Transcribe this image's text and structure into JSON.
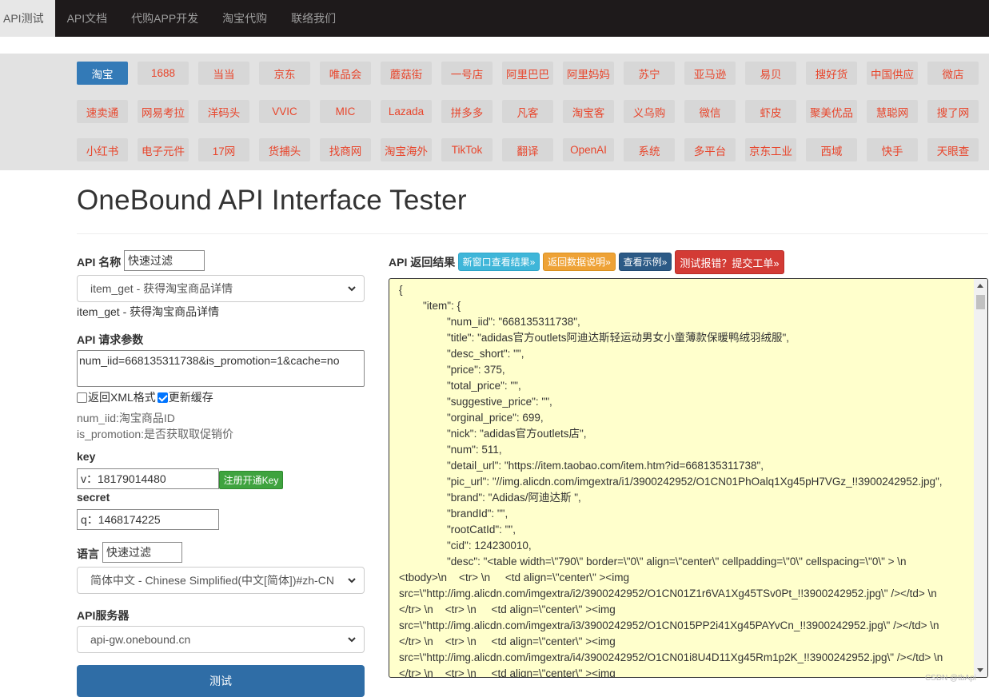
{
  "nav": {
    "items": [
      "API测试",
      "API文档",
      "代购APP开发",
      "淘宝代购",
      "联络我们"
    ]
  },
  "platforms": {
    "rows": [
      [
        "淘宝",
        "1688",
        "当当",
        "京东",
        "唯品会",
        "蘑菇街",
        "一号店",
        "阿里巴巴",
        "阿里妈妈",
        "苏宁",
        "亚马逊",
        "易贝",
        "搜好货",
        "中国供应",
        "微店"
      ],
      [
        "速卖通",
        "网易考拉",
        "洋码头",
        "VVIC",
        "MIC",
        "Lazada",
        "拼多多",
        "凡客",
        "淘宝客",
        "义乌购",
        "微信",
        "虾皮",
        "聚美优品",
        "慧聪网",
        "搜了网"
      ],
      [
        "小红书",
        "电子元件",
        "17网",
        "货捕头",
        "找商网",
        "淘宝海外",
        "TikTok",
        "翻译",
        "OpenAI",
        "系统",
        "多平台",
        "京东工业",
        "西域",
        "快手",
        "天眼查"
      ]
    ]
  },
  "page": {
    "title": "OneBound API Interface Tester"
  },
  "form": {
    "api_name_label": "API 名称",
    "filter_value": "快速过滤",
    "api_select": "item_get - 获得淘宝商品详情",
    "api_selected_text": "item_get - 获得淘宝商品详情",
    "params_label": "API 请求参数",
    "params_value": "num_iid=668135311738&is_promotion=1&cache=no",
    "xml_label": "返回XML格式",
    "cache_label": "更新缓存",
    "hint1": "num_iid:淘宝商品ID",
    "hint2": "is_promotion:是否获取取促销价",
    "key_label": "key",
    "key_value": "v：18179014480",
    "register_btn": "注册开通Key",
    "secret_label": "secret",
    "secret_value": "q：1468174225",
    "lang_label": "语言",
    "lang_filter": "快速过滤",
    "lang_select": "简体中文 - Chinese Simplified(中文[简体])#zh-CN",
    "server_label": "API服务器",
    "server_select": "api-gw.onebound.cn",
    "test_btn": "测试"
  },
  "result": {
    "label": "API 返回结果",
    "btn_new_window": "新窗口查看结果»",
    "btn_doc": "返回数据说明»",
    "btn_example": "查看示例»",
    "btn_report": "测试报错？提交工单»",
    "lines": [
      "{",
      "        \"item\": {",
      "                \"num_iid\": \"668135311738\",",
      "                \"title\": \"adidas官方outlets阿迪达斯轻运动男女小童薄款保暖鸭绒羽绒服\",",
      "                \"desc_short\": \"\",",
      "                \"price\": 375,",
      "                \"total_price\": \"\",",
      "                \"suggestive_price\": \"\",",
      "                \"orginal_price\": 699,",
      "                \"nick\": \"adidas官方outlets店\",",
      "                \"num\": 511,",
      "                \"detail_url\": \"https://item.taobao.com/item.htm?id=668135311738\",",
      "                \"pic_url\": \"//img.alicdn.com/imgextra/i1/3900242952/O1CN01PhOalq1Xg45pH7VGz_!!3900242952.jpg\",",
      "                \"brand\": \"Adidas/阿迪达斯 \",",
      "                \"brandId\": \"\",",
      "                \"rootCatId\": \"\",",
      "                \"cid\": 124230010,",
      "                \"desc\": \"<table width=\\\"790\\\" border=\\\"0\\\" align=\\\"center\\\" cellpadding=\\\"0\\\" cellspacing=\\\"0\\\" > \\n",
      "<tbody>\\n    <tr> \\n     <td align=\\\"center\\\" ><img",
      "src=\\\"http://img.alicdn.com/imgextra/i2/3900242952/O1CN01Z1r6VA1Xg45TSv0Pt_!!3900242952.jpg\\\" /></td> \\n",
      "</tr> \\n    <tr> \\n     <td align=\\\"center\\\" ><img",
      "src=\\\"http://img.alicdn.com/imgextra/i3/3900242952/O1CN015PP2i41Xg45PAYvCn_!!3900242952.jpg\\\" /></td> \\n",
      "</tr> \\n    <tr> \\n     <td align=\\\"center\\\" ><img",
      "src=\\\"http://img.alicdn.com/imgextra/i4/3900242952/O1CN01i8U4D11Xg45Rm1p2K_!!3900242952.jpg\\\" /></td> \\n",
      "</tr> \\n    <tr> \\n     <td align=\\\"center\\\" ><img"
    ]
  },
  "watermark": "CSDN @tbApi"
}
